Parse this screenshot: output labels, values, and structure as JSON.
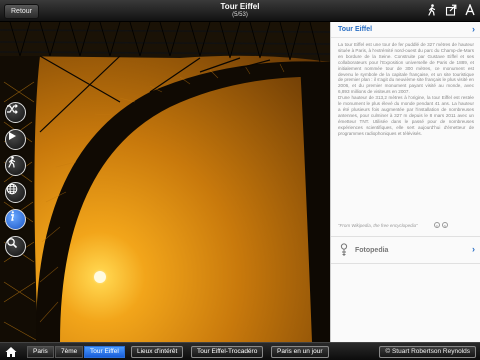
{
  "topbar": {
    "back_label": "Retour",
    "title": "Tour Eiffel",
    "counter": "(5/53)",
    "icons": [
      "walker-icon",
      "share-icon",
      "font-size-icon"
    ]
  },
  "left_buttons": [
    "shuffle-icon",
    "forward-icon",
    "walker-icon",
    "globe-icon",
    "info-icon",
    "search-icon"
  ],
  "panel": {
    "title": "Tour Eiffel",
    "article": [
      "La tour Eiffel est une tour de fer puddlé de 327 mètres de hauteur située à Paris, à l'extrémité nord-ouest du parc du Champ-de-Mars en bordure de la Seine. Construite par Gustave Eiffel et ses collaborateurs pour l'Exposition universelle de Paris de 1889, et initialement nommée tour de 300 mètres, ce monument est devenu le symbole de la capitale française, et un site touristique de premier plan : il s'agit du neuvième site français le plus visité en 2006, et du premier monument payant visité au monde, avec 6,893 millions de visiteurs en 2007.",
      "D'une hauteur de 313,2 mètres à l'origine, la tour Eiffel est restée le monument le plus élevé du monde pendant 41 ans. La hauteur a été plusieurs fois augmentée par l'installation de nombreuses antennes, pour culminer à 327 m depuis le 8 mars 2011 avec un émetteur TNT. Utilisée dans le passé pour de nombreuses expériences scientifiques, elle sert aujourd'hui d'émetteur de programmes radiophoniques et télévisés."
    ],
    "source": "\"From Wikipedia, the free encyclopedia\"",
    "fotopedia_label": "Fotopedia"
  },
  "bottombar": {
    "breadcrumbs": [
      "Paris",
      "7ème",
      "Tour Eiffel"
    ],
    "tags": [
      "Lieux d'intérêt",
      "Tour Eiffel-Trocadéro",
      "Paris en un jour"
    ],
    "credit": "Stuart Robertson Reynolds"
  },
  "colors": {
    "accent": "#2a6fc4",
    "active_crumb": "#1a5ed8",
    "sky": "#f2a51a"
  }
}
